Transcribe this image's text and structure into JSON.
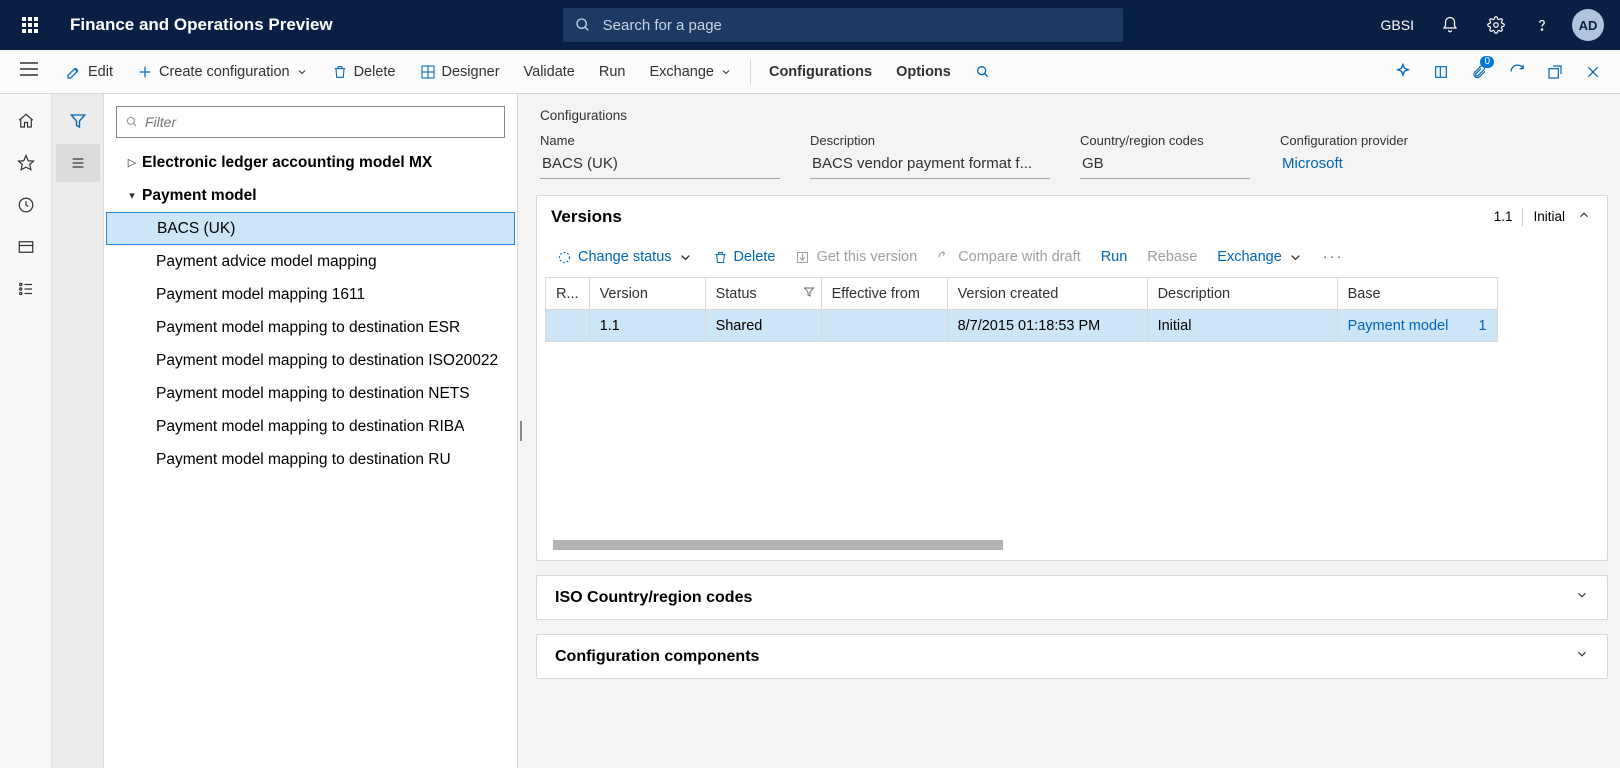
{
  "header": {
    "app_title": "Finance and Operations Preview",
    "search_placeholder": "Search for a page",
    "company": "GBSI",
    "avatar": "AD"
  },
  "commands": {
    "edit": "Edit",
    "create": "Create configuration",
    "delete": "Delete",
    "designer": "Designer",
    "validate": "Validate",
    "run": "Run",
    "exchange": "Exchange",
    "configurations": "Configurations",
    "options": "Options",
    "badge": "0"
  },
  "filter_placeholder": "Filter",
  "tree": {
    "node0": "Electronic ledger accounting model MX",
    "node1": "Payment model",
    "children": [
      "BACS (UK)",
      "Payment advice model mapping",
      "Payment model mapping 1611",
      "Payment model mapping to destination ESR",
      "Payment model mapping to destination ISO20022",
      "Payment model mapping to destination NETS",
      "Payment model mapping to destination RIBA",
      "Payment model mapping to destination RU"
    ]
  },
  "crumb": "Configurations",
  "fields": {
    "name_label": "Name",
    "name_value": "BACS (UK)",
    "desc_label": "Description",
    "desc_value": "BACS vendor payment format f...",
    "cr_label": "Country/region codes",
    "cr_value": "GB",
    "prov_label": "Configuration provider",
    "prov_value": "Microsoft"
  },
  "versions": {
    "title": "Versions",
    "sub_ver": "1.1",
    "sub_status": "Initial",
    "toolbar": {
      "change": "Change status",
      "delete": "Delete",
      "get": "Get this version",
      "compare": "Compare with draft",
      "run": "Run",
      "rebase": "Rebase",
      "exchange": "Exchange"
    },
    "cols": {
      "check": "R...",
      "version": "Version",
      "status": "Status",
      "eff": "Effective from",
      "created": "Version created",
      "desc": "Description",
      "base": "Base"
    },
    "row": {
      "version": "1.1",
      "status": "Shared",
      "eff": "",
      "created": "8/7/2015 01:18:53 PM",
      "desc": "Initial",
      "base": "Payment model",
      "base_n": "1"
    }
  },
  "accordion1": "ISO Country/region codes",
  "accordion2": "Configuration components"
}
